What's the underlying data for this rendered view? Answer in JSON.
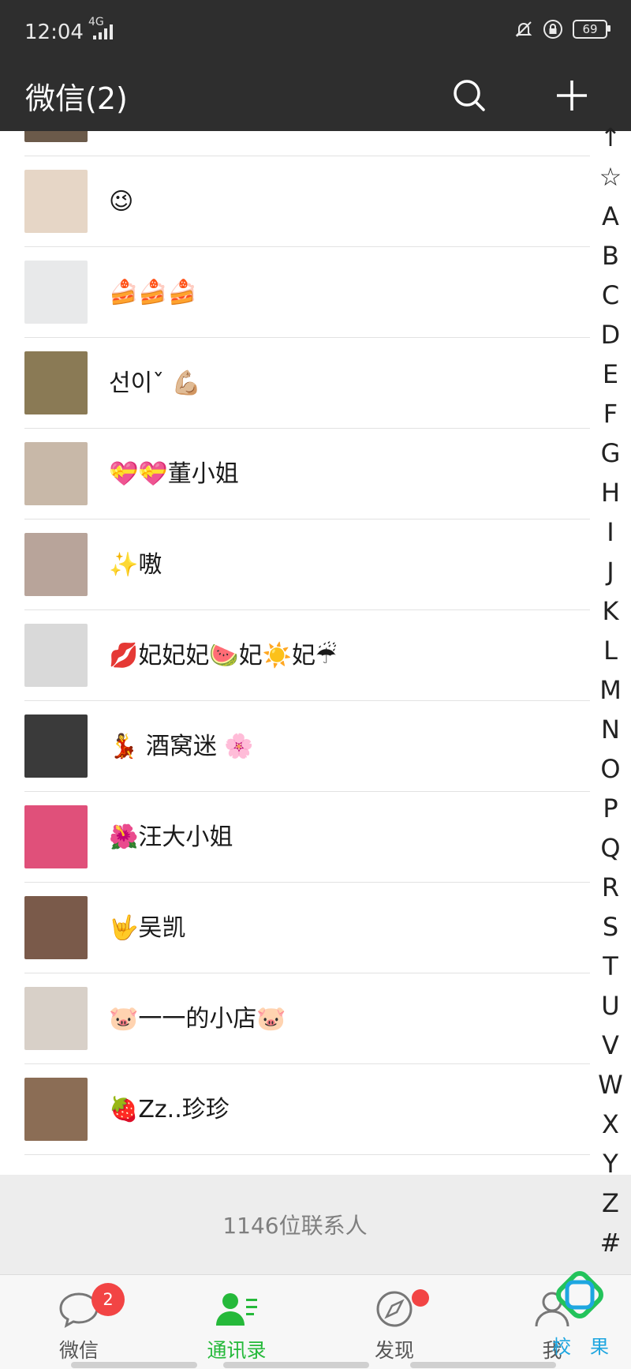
{
  "status_bar": {
    "time": "12:04",
    "network": "4G",
    "battery": "69"
  },
  "app_bar": {
    "title": "微信(2)"
  },
  "contacts": [
    {
      "name": "🍍",
      "avatar_color": "#6b5a4a"
    },
    {
      "name": "😉",
      "avatar_color": "#e6d6c6"
    },
    {
      "name": "🍰🍰🍰",
      "avatar_color": "#e8e9ea"
    },
    {
      "name": "선이ˇ  💪🏼",
      "avatar_color": "#8a7a55"
    },
    {
      "name": "💝💝董小姐",
      "avatar_color": "#c8b8a8"
    },
    {
      "name": "✨嗷",
      "avatar_color": "#b8a49a"
    },
    {
      "name": "💋妃妃妃🍉妃☀️妃☔",
      "avatar_color": "#d9d9d9"
    },
    {
      "name": "💃 酒窝迷 🌸",
      "avatar_color": "#3a3a3a"
    },
    {
      "name": "🌺汪大小姐",
      "avatar_color": "#e0507a"
    },
    {
      "name": "🤟吴凯",
      "avatar_color": "#7a5a4a"
    },
    {
      "name": "🐷一一的小店🐷",
      "avatar_color": "#d8d0c8"
    },
    {
      "name": "🍓Zz..珍珍",
      "avatar_color": "#8b6d55"
    }
  ],
  "contact_count": "1146位联系人",
  "index_letters": [
    "↑",
    "☆",
    "A",
    "B",
    "C",
    "D",
    "E",
    "F",
    "G",
    "H",
    "I",
    "J",
    "K",
    "L",
    "M",
    "N",
    "O",
    "P",
    "Q",
    "R",
    "S",
    "T",
    "U",
    "V",
    "W",
    "X",
    "Y",
    "Z",
    "#"
  ],
  "tabs": [
    {
      "label": "微信",
      "badge": "2",
      "icon": "chat-bubble-icon"
    },
    {
      "label": "通讯录",
      "active": true,
      "icon": "contacts-icon"
    },
    {
      "label": "发现",
      "dot": true,
      "icon": "compass-icon"
    },
    {
      "label": "我",
      "icon": "person-icon"
    }
  ],
  "watermark": {
    "text": "校果"
  },
  "colors": {
    "bar_bg": "#2e2e2e",
    "active_green": "#25b93a",
    "badge_red": "#f24444"
  }
}
